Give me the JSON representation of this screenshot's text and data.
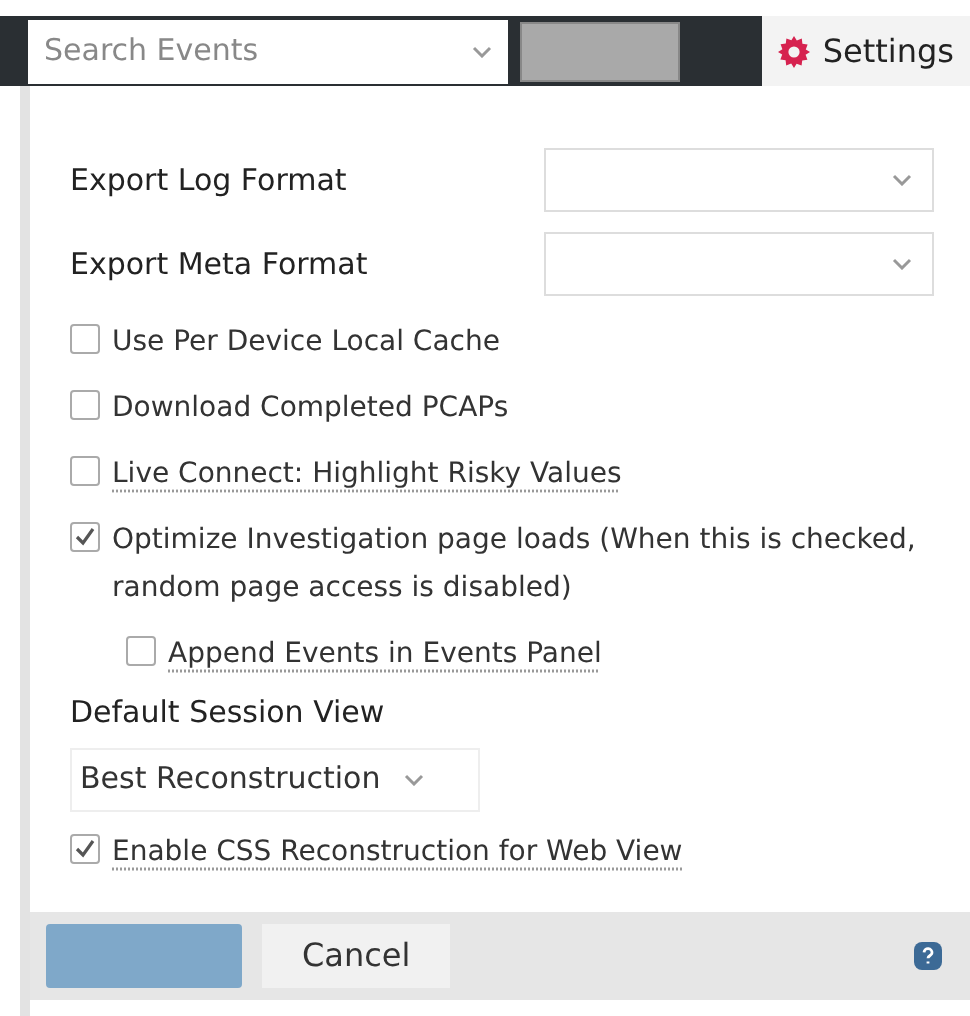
{
  "toolbar": {
    "search": {
      "placeholder": "Search Events"
    },
    "settings_tab": {
      "label": "Settings",
      "selected": true
    }
  },
  "format_fields": [
    {
      "label": "Export Log Format"
    },
    {
      "label": "Export Meta Format"
    }
  ],
  "options": [
    {
      "label": "Use Per Device Local Cache",
      "checked": false,
      "underlined": false,
      "indented": false
    },
    {
      "label": "Download Completed PCAPs",
      "checked": false,
      "underlined": false,
      "indented": false
    },
    {
      "label": "Live Connect: Highlight Risky Values",
      "checked": false,
      "underlined": true,
      "indented": false
    },
    {
      "label": "Optimize Investigation page loads (When this is checked, random page access is disabled)",
      "checked": true,
      "underlined": false,
      "indented": false
    },
    {
      "label": "Append Events in Events Panel",
      "checked": false,
      "underlined": true,
      "indented": true
    }
  ],
  "session_view": {
    "label": "Default Session View",
    "value": "Best Reconstruction"
  },
  "css_option": {
    "label": "Enable CSS Reconstruction for Web View",
    "checked": true,
    "underlined": true
  },
  "footer": {
    "cancel": "Cancel"
  }
}
